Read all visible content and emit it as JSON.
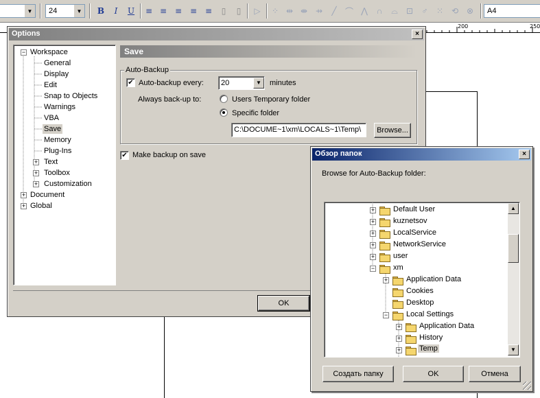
{
  "toolbar": {
    "font_size": "24",
    "page_size": "A4",
    "bold": "B",
    "italic": "I",
    "underline": "U"
  },
  "ruler": {
    "labels": [
      "200",
      "250"
    ]
  },
  "options": {
    "title": "Options",
    "close": "×",
    "tree": {
      "workspace": "Workspace",
      "general": "General",
      "display": "Display",
      "edit": "Edit",
      "snap": "Snap to Objects",
      "warnings": "Warnings",
      "vba": "VBA",
      "save": "Save",
      "memory": "Memory",
      "plugins": "Plug-Ins",
      "text": "Text",
      "toolbox": "Toolbox",
      "customization": "Customization",
      "document": "Document",
      "global": "Global"
    },
    "page_header": "Save",
    "autobackup_group": "Auto-Backup",
    "autobackup_label": "Auto-backup every:",
    "autobackup_value": "20",
    "minutes": "minutes",
    "always_label": "Always back-up to:",
    "radio_temp": "Users Temporary folder",
    "radio_specific": "Specific folder",
    "folder_path": "C:\\DOCUME~1\\xm\\LOCALS~1\\Temp\\",
    "browse_btn": "Browse...",
    "make_backup": "Make backup on save",
    "ok_btn": "OK",
    "check_mark": "✔",
    "plus": "+",
    "minus": "−"
  },
  "browse": {
    "title": "Обзор папок",
    "close": "×",
    "prompt": "Browse for Auto-Backup folder:",
    "items": [
      "Default User",
      "kuznetsov",
      "LocalService",
      "NetworkService",
      "user",
      "xm",
      "Application Data",
      "Cookies",
      "Desktop",
      "Local Settings",
      "Application Data",
      "History",
      "Temp"
    ],
    "new_folder_btn": "Создать папку",
    "ok_btn": "OK",
    "cancel_btn": "Отмена",
    "up_arrow": "▲",
    "down_arrow": "▼"
  }
}
